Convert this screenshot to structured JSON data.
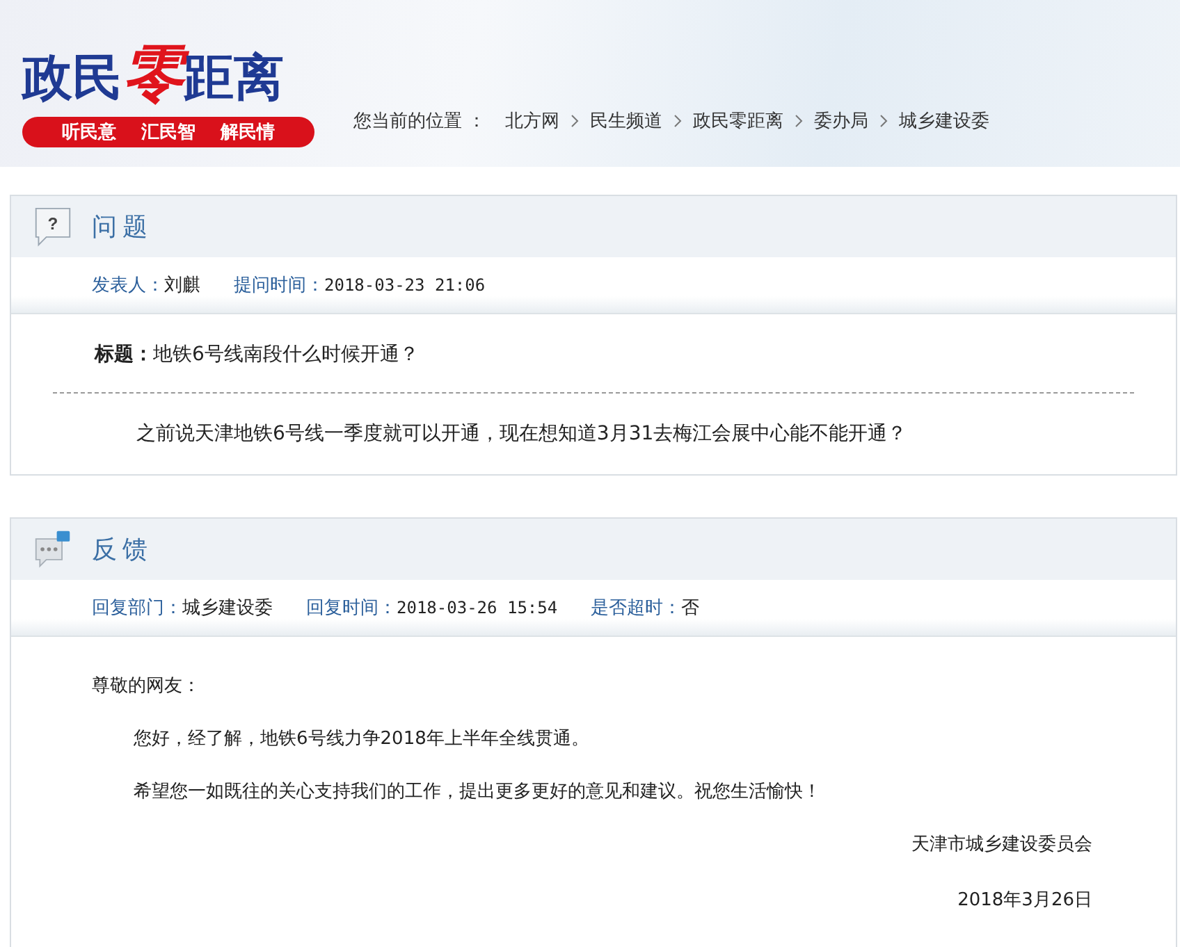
{
  "header": {
    "logo": [
      {
        "text": "政民",
        "kind": "plain"
      },
      {
        "text": "零",
        "kind": "accent"
      },
      {
        "text": "距离",
        "kind": "plain"
      }
    ],
    "slogans": [
      "听民意",
      "汇民智",
      "解民情"
    ],
    "breadcrumb_label": "您当前的位置 ：",
    "breadcrumb": [
      "北方网",
      "民生频道",
      "政民零距离",
      "委办局",
      "城乡建设委"
    ]
  },
  "question": {
    "title": "问题",
    "icon_glyph": "?",
    "meta": [
      {
        "label": "发表人：",
        "value": "刘麒",
        "kind": "text"
      },
      {
        "label": "提问时间：",
        "value": "2018-03-23 21:06",
        "kind": "mono"
      }
    ],
    "subject_label": "标题：",
    "subject": "地铁6号线南段什么时候开通？",
    "content": "之前说天津地铁6号线一季度就可以开通，现在想知道3月31去梅江会展中心能不能开通？"
  },
  "feedback": {
    "title": "反馈",
    "meta": [
      {
        "label": "回复部门：",
        "value": "城乡建设委",
        "kind": "text"
      },
      {
        "label": "回复时间：",
        "value": "2018-03-26 15:54",
        "kind": "mono"
      },
      {
        "label": "是否超时：",
        "value": "否",
        "kind": "text"
      }
    ],
    "greeting": "尊敬的网友：",
    "paragraphs": [
      "您好，经了解，地铁6号线力争2018年上半年全线贯通。",
      "希望您一如既往的关心支持我们的工作，提出更多更好的意见和建议。祝您生活愉快！"
    ],
    "signature": "天津市城乡建设委员会",
    "date": "2018年3月26日"
  }
}
